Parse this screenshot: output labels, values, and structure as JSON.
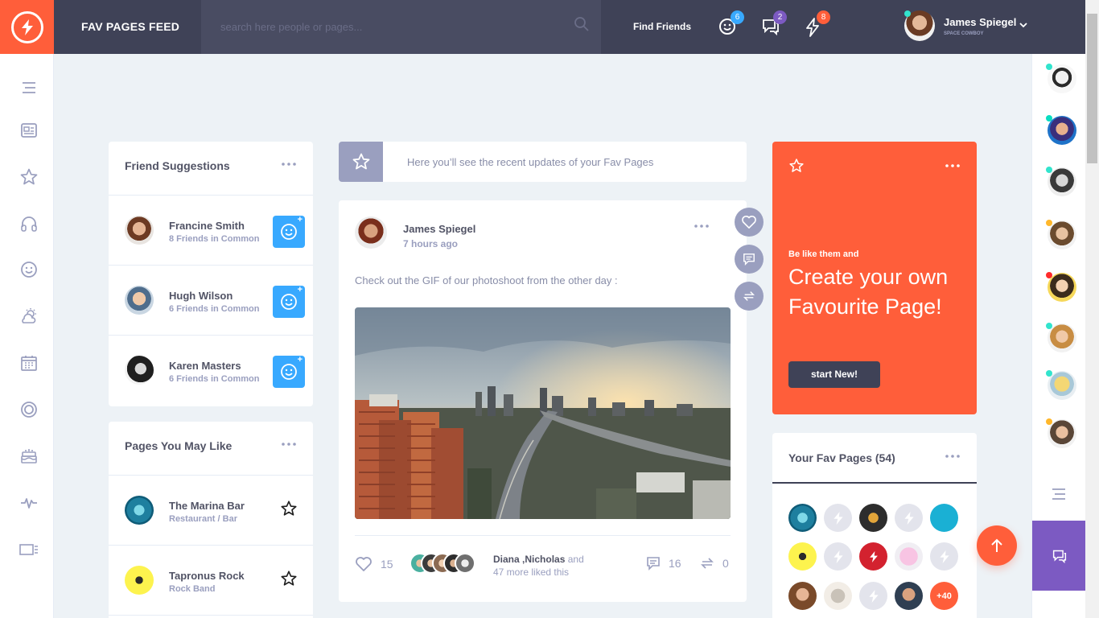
{
  "header": {
    "title": "FAV PAGES FEED",
    "search_placeholder": "search here people or pages...",
    "find_friends": "Find Friends",
    "badges": {
      "friend_requests": "6",
      "messages": "2",
      "notifications": "8"
    },
    "badge_colors": {
      "friend_requests": "#38a9ff",
      "messages": "#7c5ac2",
      "notifications": "#ff5e3a"
    },
    "user": {
      "name": "James Spiegel",
      "subtitle": "SPACE COWBOY"
    }
  },
  "left_sidebar": {
    "icons": [
      "menu-icon",
      "newsfeed-icon",
      "star-icon",
      "headphones-icon",
      "smiley-icon",
      "weather-icon",
      "calendar-icon",
      "target-icon",
      "cake-icon",
      "pulse-icon",
      "widget-icon"
    ]
  },
  "friend_suggestions": {
    "title": "Friend Suggestions",
    "items": [
      {
        "name": "Francine Smith",
        "common": "8 Friends in Common"
      },
      {
        "name": "Hugh Wilson",
        "common": "6 Friends in Common"
      },
      {
        "name": "Karen Masters",
        "common": "6 Friends in Common"
      }
    ]
  },
  "pages_you_may_like": {
    "title": "Pages You May Like",
    "items": [
      {
        "name": "The Marina Bar",
        "category": "Restaurant / Bar"
      },
      {
        "name": "Tapronus Rock",
        "category": "Rock Band"
      }
    ]
  },
  "info_bar": {
    "text": "Here you’ll see the recent updates of your Fav Pages"
  },
  "post": {
    "author": "James Spiegel",
    "time": "7 hours ago",
    "text": "Check out the GIF of our photoshoot from the other day :",
    "likes": "15",
    "liked_names_1": "Diana",
    "liked_names_2": ",Nicholas",
    "liked_and": "and",
    "liked_more": "47 more liked this",
    "comments": "16",
    "shares": "0"
  },
  "promo": {
    "small": "Be like them and",
    "big": "Create your own Favourite Page!",
    "button": "start New!"
  },
  "fav_pages": {
    "title": "Your Fav Pages (54)",
    "more_count": "+40",
    "accent": "#ff5e3a"
  }
}
